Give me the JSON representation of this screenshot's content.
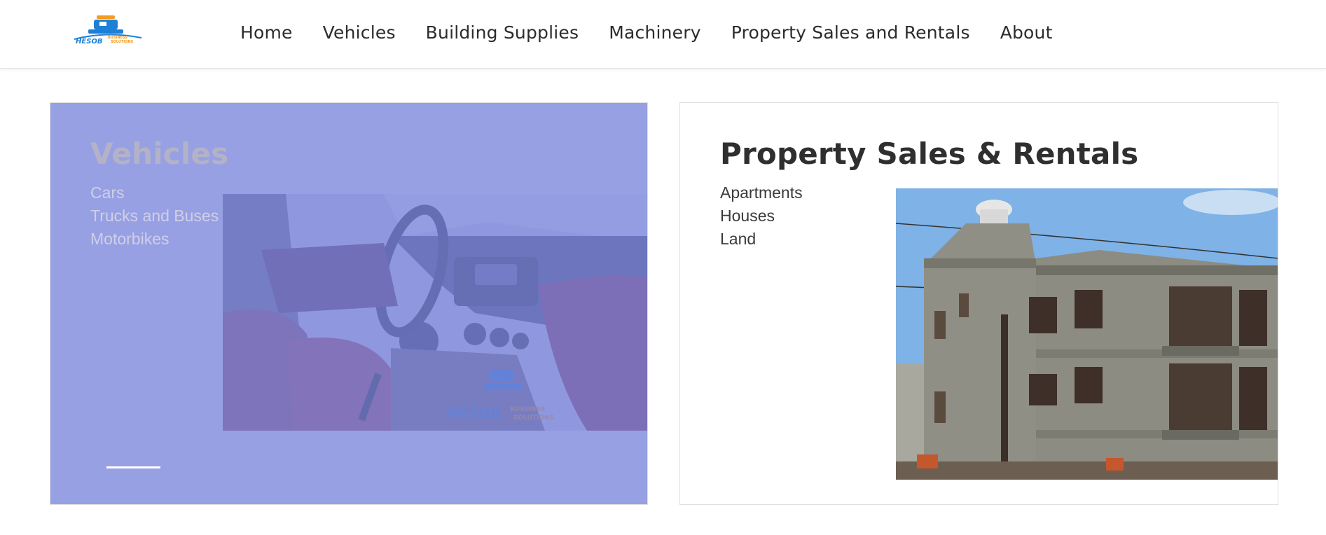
{
  "header": {
    "logo": {
      "icon": "truck-logo-icon",
      "text": "HESOB",
      "tagline": "BUSINESS SOLUTIONS",
      "colors": {
        "blue": "#1d7fd6",
        "orange": "#f39c1f"
      }
    },
    "nav": [
      {
        "label": "Home"
      },
      {
        "label": "Vehicles"
      },
      {
        "label": "Building Supplies"
      },
      {
        "label": "Machinery"
      },
      {
        "label": "Property Sales and Rentals"
      },
      {
        "label": "About"
      }
    ]
  },
  "cards": {
    "vehicles": {
      "title": "Vehicles",
      "items": [
        "Cars",
        "Trucks and Buses",
        "Motorbikes"
      ],
      "image": "car-interior-photo",
      "overlay_color": "#7882dc"
    },
    "property": {
      "title": "Property Sales & Rentals",
      "items": [
        "Apartments",
        "Houses",
        "Land"
      ],
      "image": "building-photo"
    }
  }
}
